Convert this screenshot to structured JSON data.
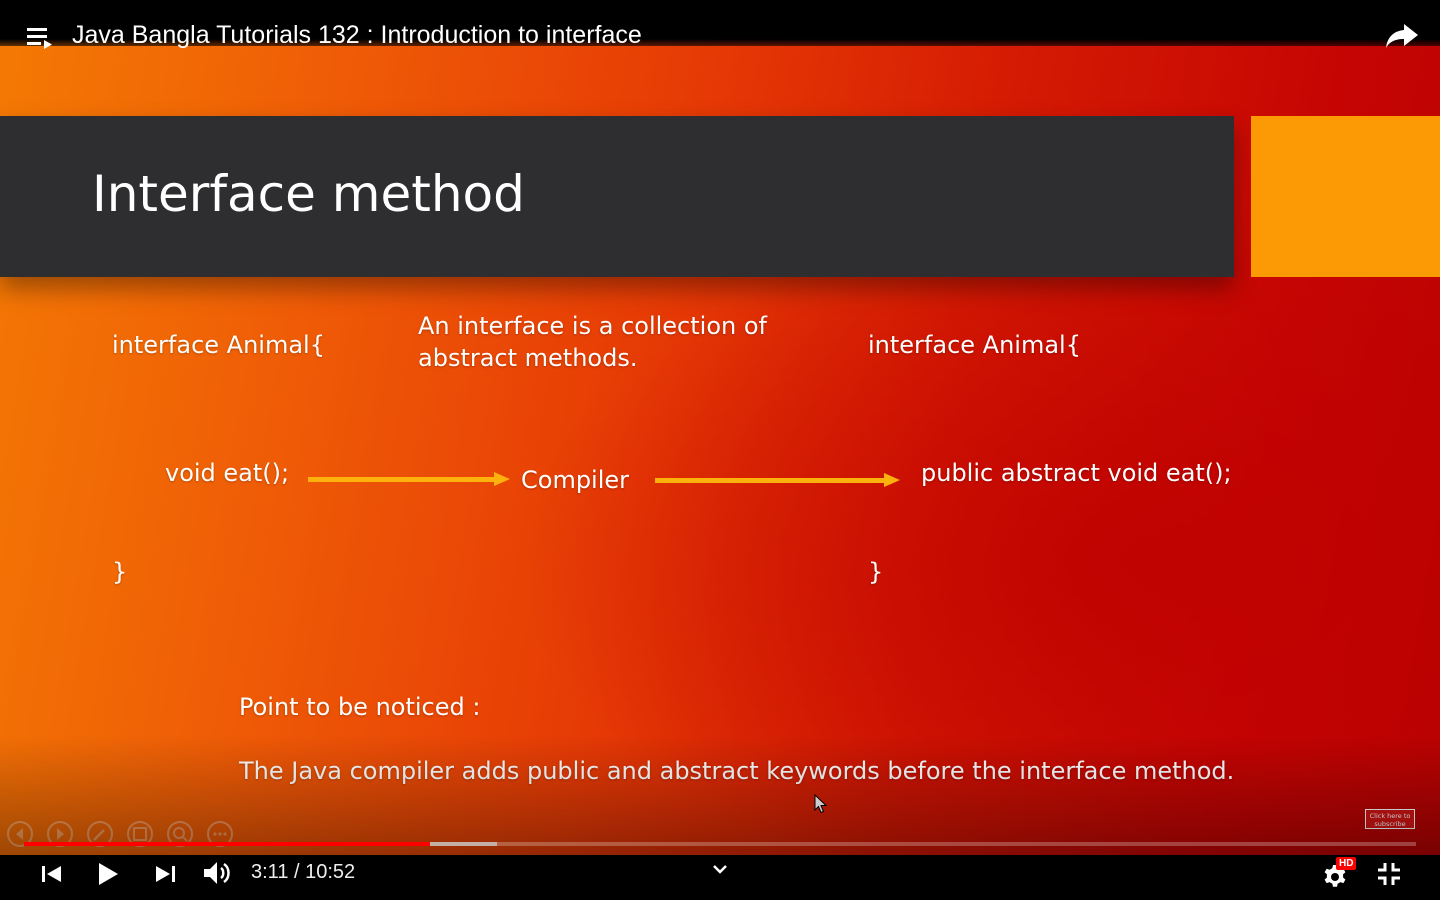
{
  "player": {
    "title": "Java Bangla Tutorials 132 : Introduction to interface",
    "time_current": "3:11",
    "time_separator": " / ",
    "time_total": "10:52",
    "progress_played": 0.2919,
    "progress_buffered": 0.3399,
    "quality_badge": "HD",
    "subscribe_text": "Click here to subscribe",
    "accent_color": "#ff0000"
  },
  "slide": {
    "title": "Interface method",
    "left_code": {
      "open": "interface Animal{",
      "method": "void eat();",
      "close": "}"
    },
    "description": "An interface is a collection of abstract methods.",
    "compiler_label": "Compiler",
    "right_code": {
      "open": "interface Animal{",
      "method": "public abstract void eat();",
      "close": "}"
    },
    "note_heading": "Point to be noticed :",
    "note_text": "The Java compiler adds public and abstract keywords before the interface method.",
    "colors": {
      "header_bar": "#2e2d30",
      "accent_block": "#fb9a04",
      "arrow": "#fdb10c"
    }
  },
  "icons": {
    "top_left": "playlist-icon",
    "top_right": "share-icon",
    "controls": [
      "previous-icon",
      "play-icon",
      "next-icon",
      "volume-icon",
      "chevron-down-icon",
      "settings-icon",
      "exit-fullscreen-icon"
    ],
    "slide_nav": [
      "slide-prev-icon",
      "slide-next-icon",
      "pen-icon",
      "slides-grid-icon",
      "zoom-icon",
      "more-icon"
    ]
  }
}
